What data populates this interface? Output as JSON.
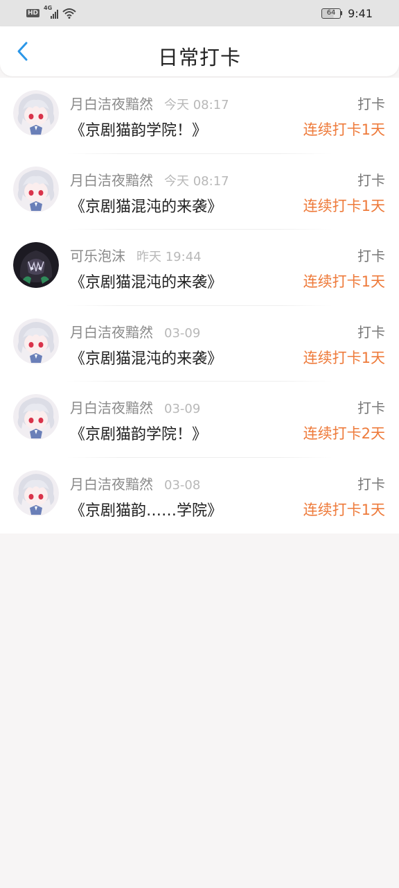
{
  "status_bar": {
    "hd": "HD",
    "network": "4G",
    "battery": "64",
    "time": "9:41"
  },
  "header": {
    "title": "日常打卡",
    "back_icon": "chevron-left-icon",
    "accent_color": "#2b97e8"
  },
  "colors": {
    "streak": "#ee7a3a",
    "muted": "#8a8a8a"
  },
  "checkins": [
    {
      "user": "月白洁夜黯然",
      "time": "今天 08:17",
      "book": "《京剧猫韵学院！》",
      "type": "打卡",
      "streak": "连续打卡1天",
      "avatar": "anime-avatar-white-hair"
    },
    {
      "user": "月白洁夜黯然",
      "time": "今天 08:17",
      "book": "《京剧猫混沌的来袭》",
      "type": "打卡",
      "streak": "连续打卡1天",
      "avatar": "anime-avatar-white-hair"
    },
    {
      "user": "可乐泡沫",
      "time": "昨天 19:44",
      "book": "《京剧猫混沌的来袭》",
      "type": "打卡",
      "streak": "连续打卡1天",
      "avatar": "anime-avatar-dark-hood"
    },
    {
      "user": "月白洁夜黯然",
      "time": "03-09",
      "book": "《京剧猫混沌的来袭》",
      "type": "打卡",
      "streak": "连续打卡1天",
      "avatar": "anime-avatar-white-hair"
    },
    {
      "user": "月白洁夜黯然",
      "time": "03-09",
      "book": "《京剧猫韵学院！》",
      "type": "打卡",
      "streak": "连续打卡2天",
      "avatar": "anime-avatar-white-hair"
    },
    {
      "user": "月白洁夜黯然",
      "time": "03-08",
      "book": "《京剧猫韵……学院》",
      "type": "打卡",
      "streak": "连续打卡1天",
      "avatar": "anime-avatar-white-hair"
    }
  ]
}
